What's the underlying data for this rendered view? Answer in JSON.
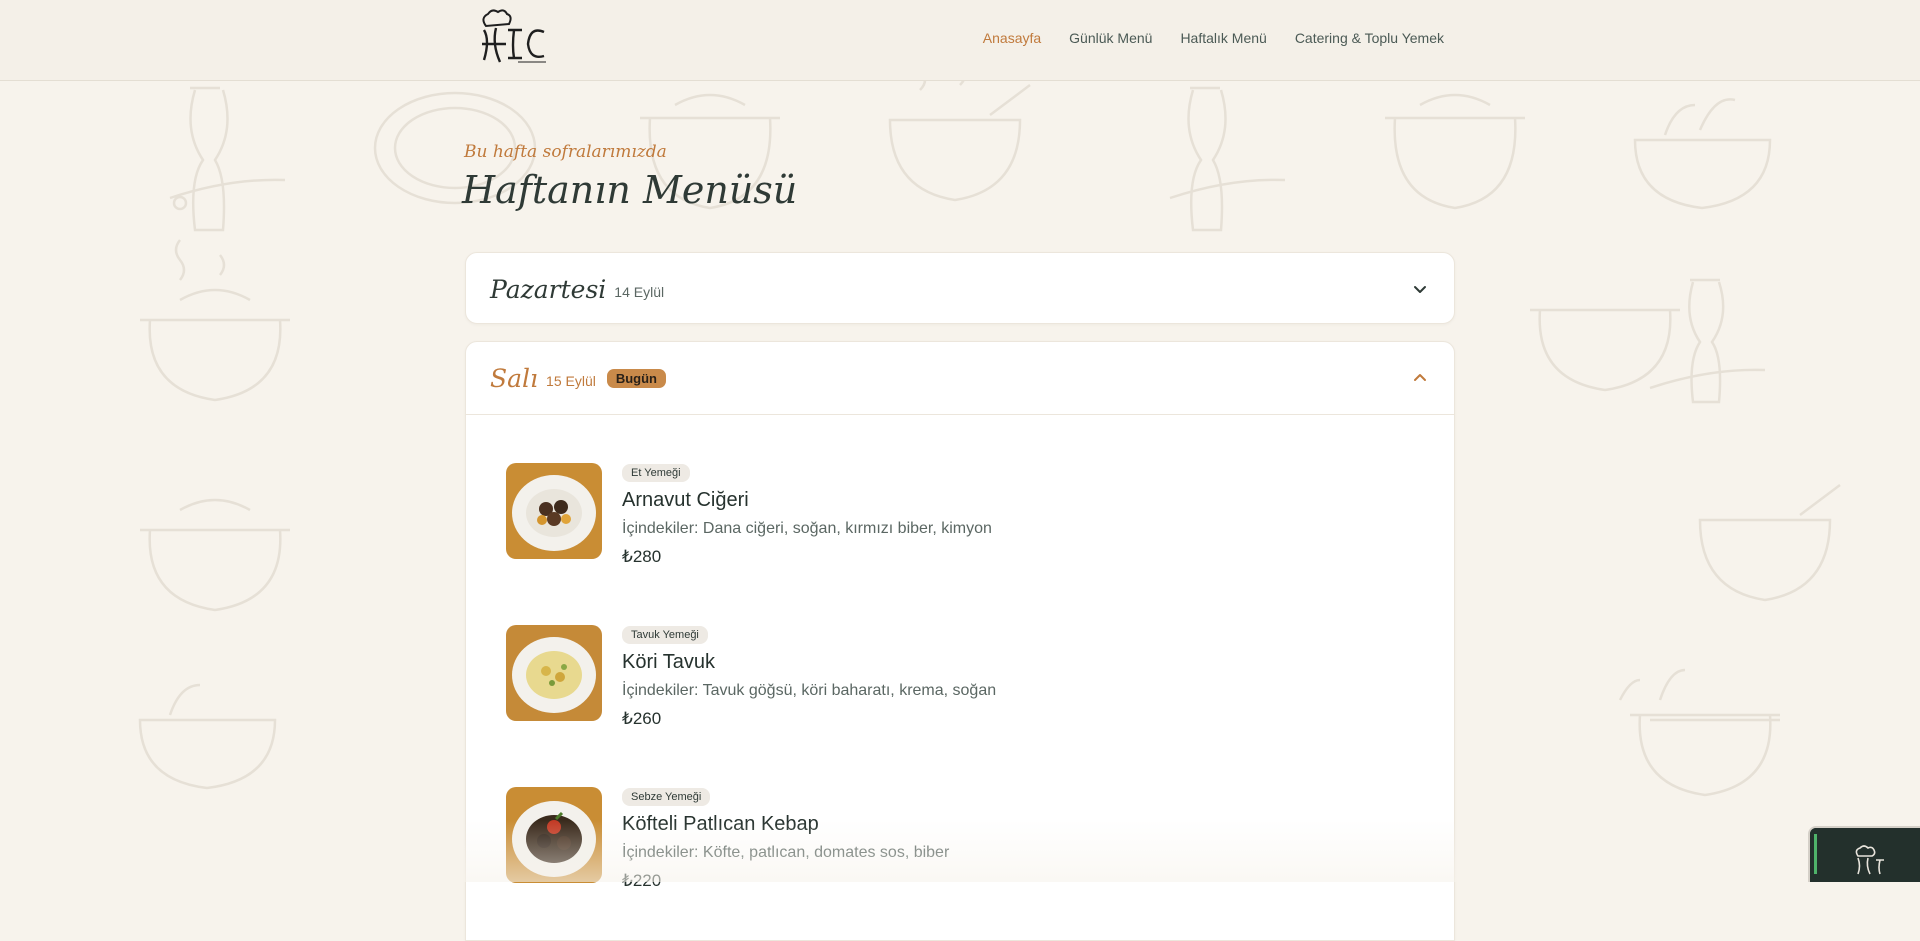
{
  "header": {
    "logo_text": "HIC",
    "nav": [
      {
        "label": "Anasayfa",
        "active": true
      },
      {
        "label": "Günlük Menü",
        "active": false
      },
      {
        "label": "Haftalık Menü",
        "active": false
      },
      {
        "label": "Catering & Toplu Yemek",
        "active": false
      }
    ]
  },
  "hero": {
    "subtitle": "Bu hafta sofralarımızda",
    "title": "Haftanın Menüsü"
  },
  "days": [
    {
      "name": "Pazartesi",
      "date": "14 Eylül",
      "expanded": false
    },
    {
      "name": "Salı",
      "date": "15 Eylül",
      "badge": "Bugün",
      "expanded": true,
      "dishes": [
        {
          "tag": "Et Yemeği",
          "name": "Arnavut Ciğeri",
          "ingredients": "İçindekiler: Dana ciğeri, soğan, kırmızı biber, kimyon",
          "price": "₺280"
        },
        {
          "tag": "Tavuk Yemeği",
          "name": "Köri Tavuk",
          "ingredients": "İçindekiler: Tavuk göğsü, köri baharatı, krema, soğan",
          "price": "₺260"
        },
        {
          "tag": "Sebze Yemeği",
          "name": "Köfteli Patlıcan Kebap",
          "ingredients": "İçindekiler: Köfte, patlıcan, domates sos, biber",
          "price": "₺220"
        }
      ]
    }
  ],
  "colors": {
    "accent": "#c07a3c",
    "background": "#f7f3ec",
    "badge": "#c98a4a",
    "text": "#2f3a36"
  },
  "icons": {
    "expand": "chevron-down-icon",
    "collapse": "chevron-up-icon"
  }
}
